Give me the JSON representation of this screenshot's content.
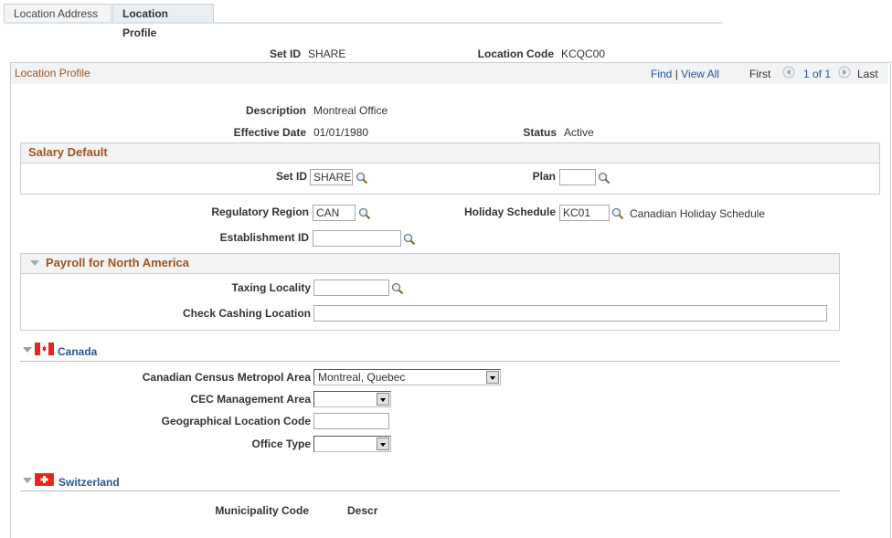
{
  "tabs": [
    {
      "label": "Location Address",
      "active": false
    },
    {
      "label": "Location Profile",
      "active": true
    }
  ],
  "header": {
    "setid_label": "Set ID",
    "setid_value": "SHARE",
    "location_code_label": "Location Code",
    "location_code_value": "KCQC00"
  },
  "group": {
    "title": "Location Profile",
    "find": "Find",
    "separator": "|",
    "view_all": "View All",
    "first": "First",
    "counter": "1 of 1",
    "last": "Last"
  },
  "profile": {
    "description_label": "Description",
    "description_value": "Montreal Office",
    "effdt_label": "Effective Date",
    "effdt_value": "01/01/1980",
    "status_label": "Status",
    "status_value": "Active"
  },
  "salary_default": {
    "title": "Salary Default",
    "setid_label": "Set ID",
    "setid_value": "SHARE",
    "plan_label": "Plan",
    "plan_value": ""
  },
  "regulatory": {
    "region_label": "Regulatory Region",
    "region_value": "CAN",
    "holiday_label": "Holiday Schedule",
    "holiday_value": "KC01",
    "holiday_descr": "Canadian Holiday Schedule",
    "establishment_label": "Establishment ID",
    "establishment_value": ""
  },
  "payroll": {
    "title": "Payroll for North America",
    "taxing_label": "Taxing Locality",
    "taxing_value": "",
    "check_cashing_label": "Check Cashing Location",
    "check_cashing_value": ""
  },
  "canada": {
    "title": "Canada",
    "census_label": "Canadian Census Metropol Area",
    "census_value": "Montreal, Quebec",
    "cec_label": "CEC Management Area",
    "cec_value": "",
    "geo_label": "Geographical Location Code",
    "geo_value": "",
    "office_type_label": "Office Type",
    "office_type_value": ""
  },
  "switzerland": {
    "title": "Switzerland",
    "municipality_label": "Municipality Code",
    "descr_label": "Descr"
  },
  "colors": {
    "section_title": "#a0541f",
    "link": "#2a5594",
    "header_bg": "#f1f3f4"
  }
}
